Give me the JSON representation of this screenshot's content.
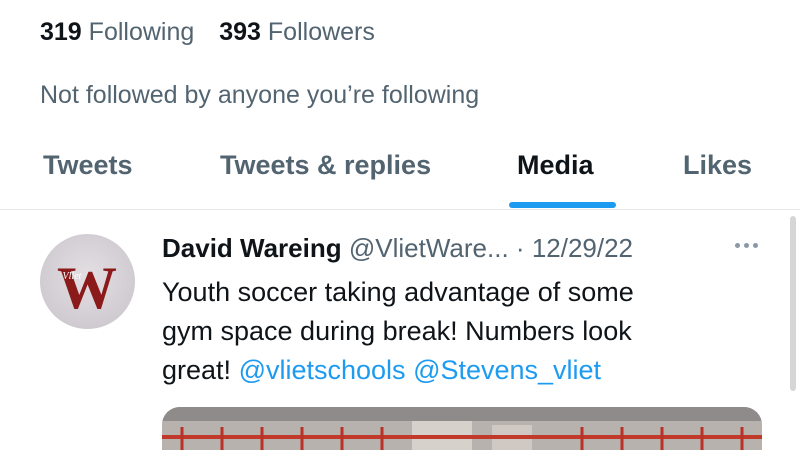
{
  "profile": {
    "following_count": "319",
    "following_label": "Following",
    "followers_count": "393",
    "followers_label": "Followers",
    "not_followed_text": "Not followed by anyone you’re following"
  },
  "tabs": [
    {
      "label": "Tweets",
      "active": false
    },
    {
      "label": "Tweets & replies",
      "active": false
    },
    {
      "label": "Media",
      "active": true
    },
    {
      "label": "Likes",
      "active": false
    }
  ],
  "tweet": {
    "author_name": "David Wareing",
    "handle": "@VlietWare...",
    "separator": "·",
    "date": "12/29/22",
    "text_line1": "Youth soccer taking advantage of some",
    "text_line2": "gym space during break! Numbers look",
    "text_line3_prefix": "great!",
    "mention1": "@vlietschools",
    "mention2": "@Stevens_vliet",
    "avatar_logo_text": "Vliet",
    "avatar_logo_letter": "W"
  },
  "colors": {
    "accent": "#1d9bf0",
    "text_primary": "#0f1419",
    "text_secondary": "#536471",
    "logo_red": "#8b1a1a"
  },
  "icons": {
    "more": "more-horizontal-icon"
  }
}
